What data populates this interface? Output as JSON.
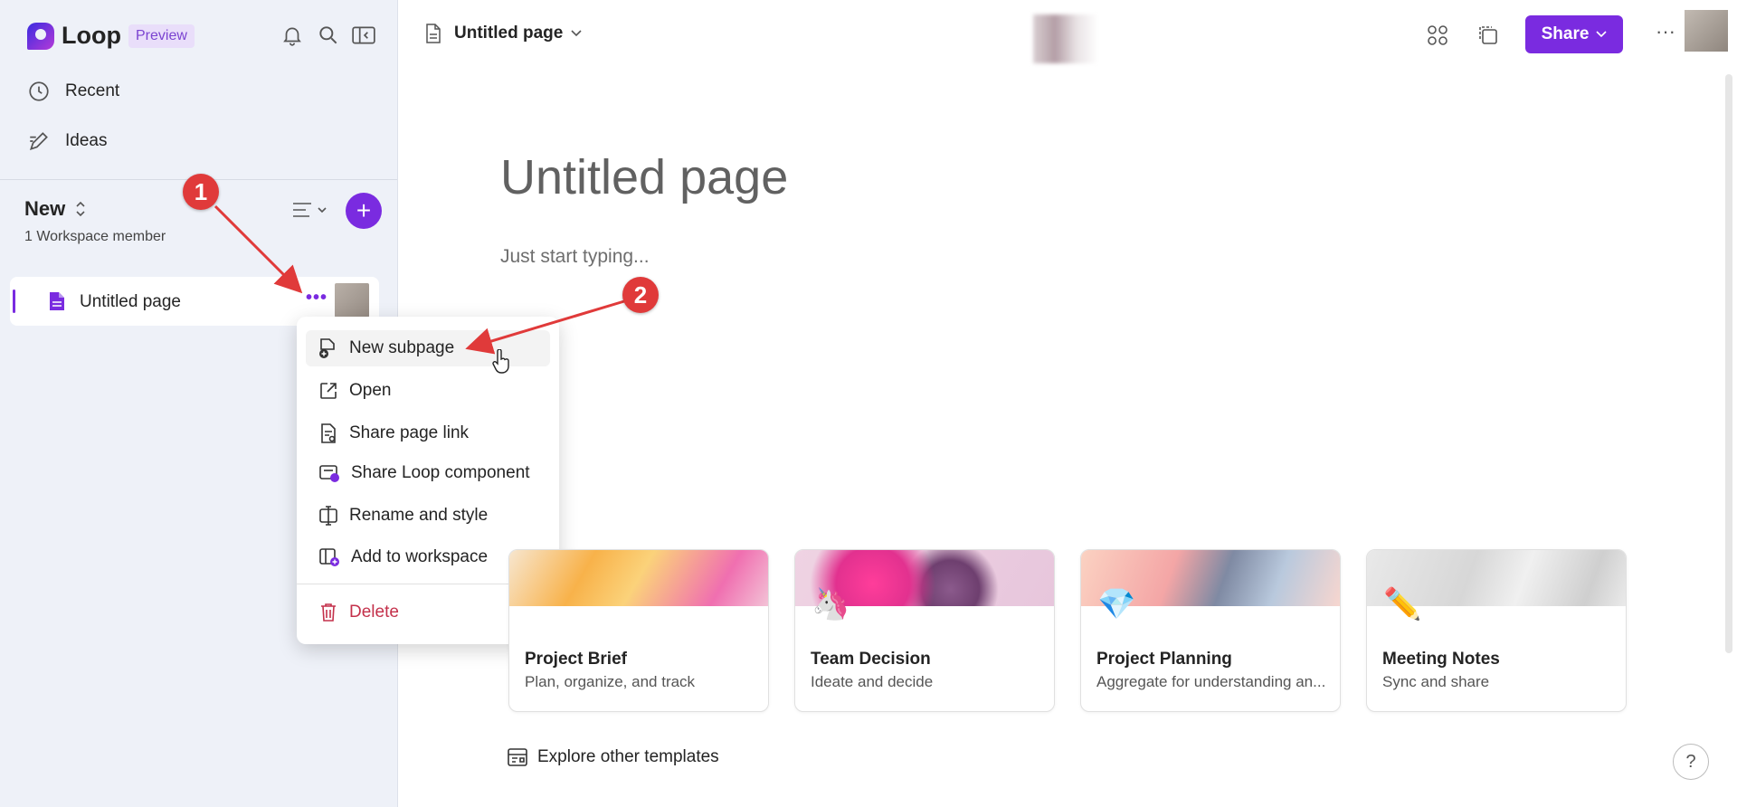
{
  "sidebar": {
    "logo_text": "Loop",
    "preview_label": "Preview",
    "nav": [
      {
        "label": "Recent",
        "icon": "clock-icon"
      },
      {
        "label": "Ideas",
        "icon": "pen-icon"
      }
    ],
    "workspace": {
      "title": "New",
      "members": "1 Workspace member"
    },
    "page_item": "Untitled page",
    "page_item_more": "•••"
  },
  "context_menu": {
    "items": [
      {
        "label": "New subpage",
        "icon": "new-subpage-icon"
      },
      {
        "label": "Open",
        "icon": "open-external-icon"
      },
      {
        "label": "Share page link",
        "icon": "share-link-icon"
      },
      {
        "label": "Share Loop component",
        "icon": "loop-component-icon"
      },
      {
        "label": "Rename and style",
        "icon": "rename-icon"
      },
      {
        "label": "Add to workspace",
        "icon": "add-workspace-icon"
      }
    ],
    "delete_label": "Delete"
  },
  "header": {
    "breadcrumb": "Untitled page",
    "share_label": "Share",
    "more_label": "···"
  },
  "content": {
    "title": "Untitled page",
    "placeholder": "Just start typing...",
    "templates": [
      {
        "title": "Project Brief",
        "subtitle": "Plan, organize, and track"
      },
      {
        "title": "Team Decision",
        "subtitle": "Ideate and decide"
      },
      {
        "title": "Project Planning",
        "subtitle": "Aggregate for understanding an..."
      },
      {
        "title": "Meeting Notes",
        "subtitle": "Sync and share"
      }
    ],
    "explore_label": "Explore other templates",
    "help_label": "?"
  },
  "annotations": {
    "step1": "1",
    "step2": "2"
  },
  "colors": {
    "accent": "#7a2be0",
    "callout": "#e03a3a",
    "delete": "#c4314b"
  }
}
